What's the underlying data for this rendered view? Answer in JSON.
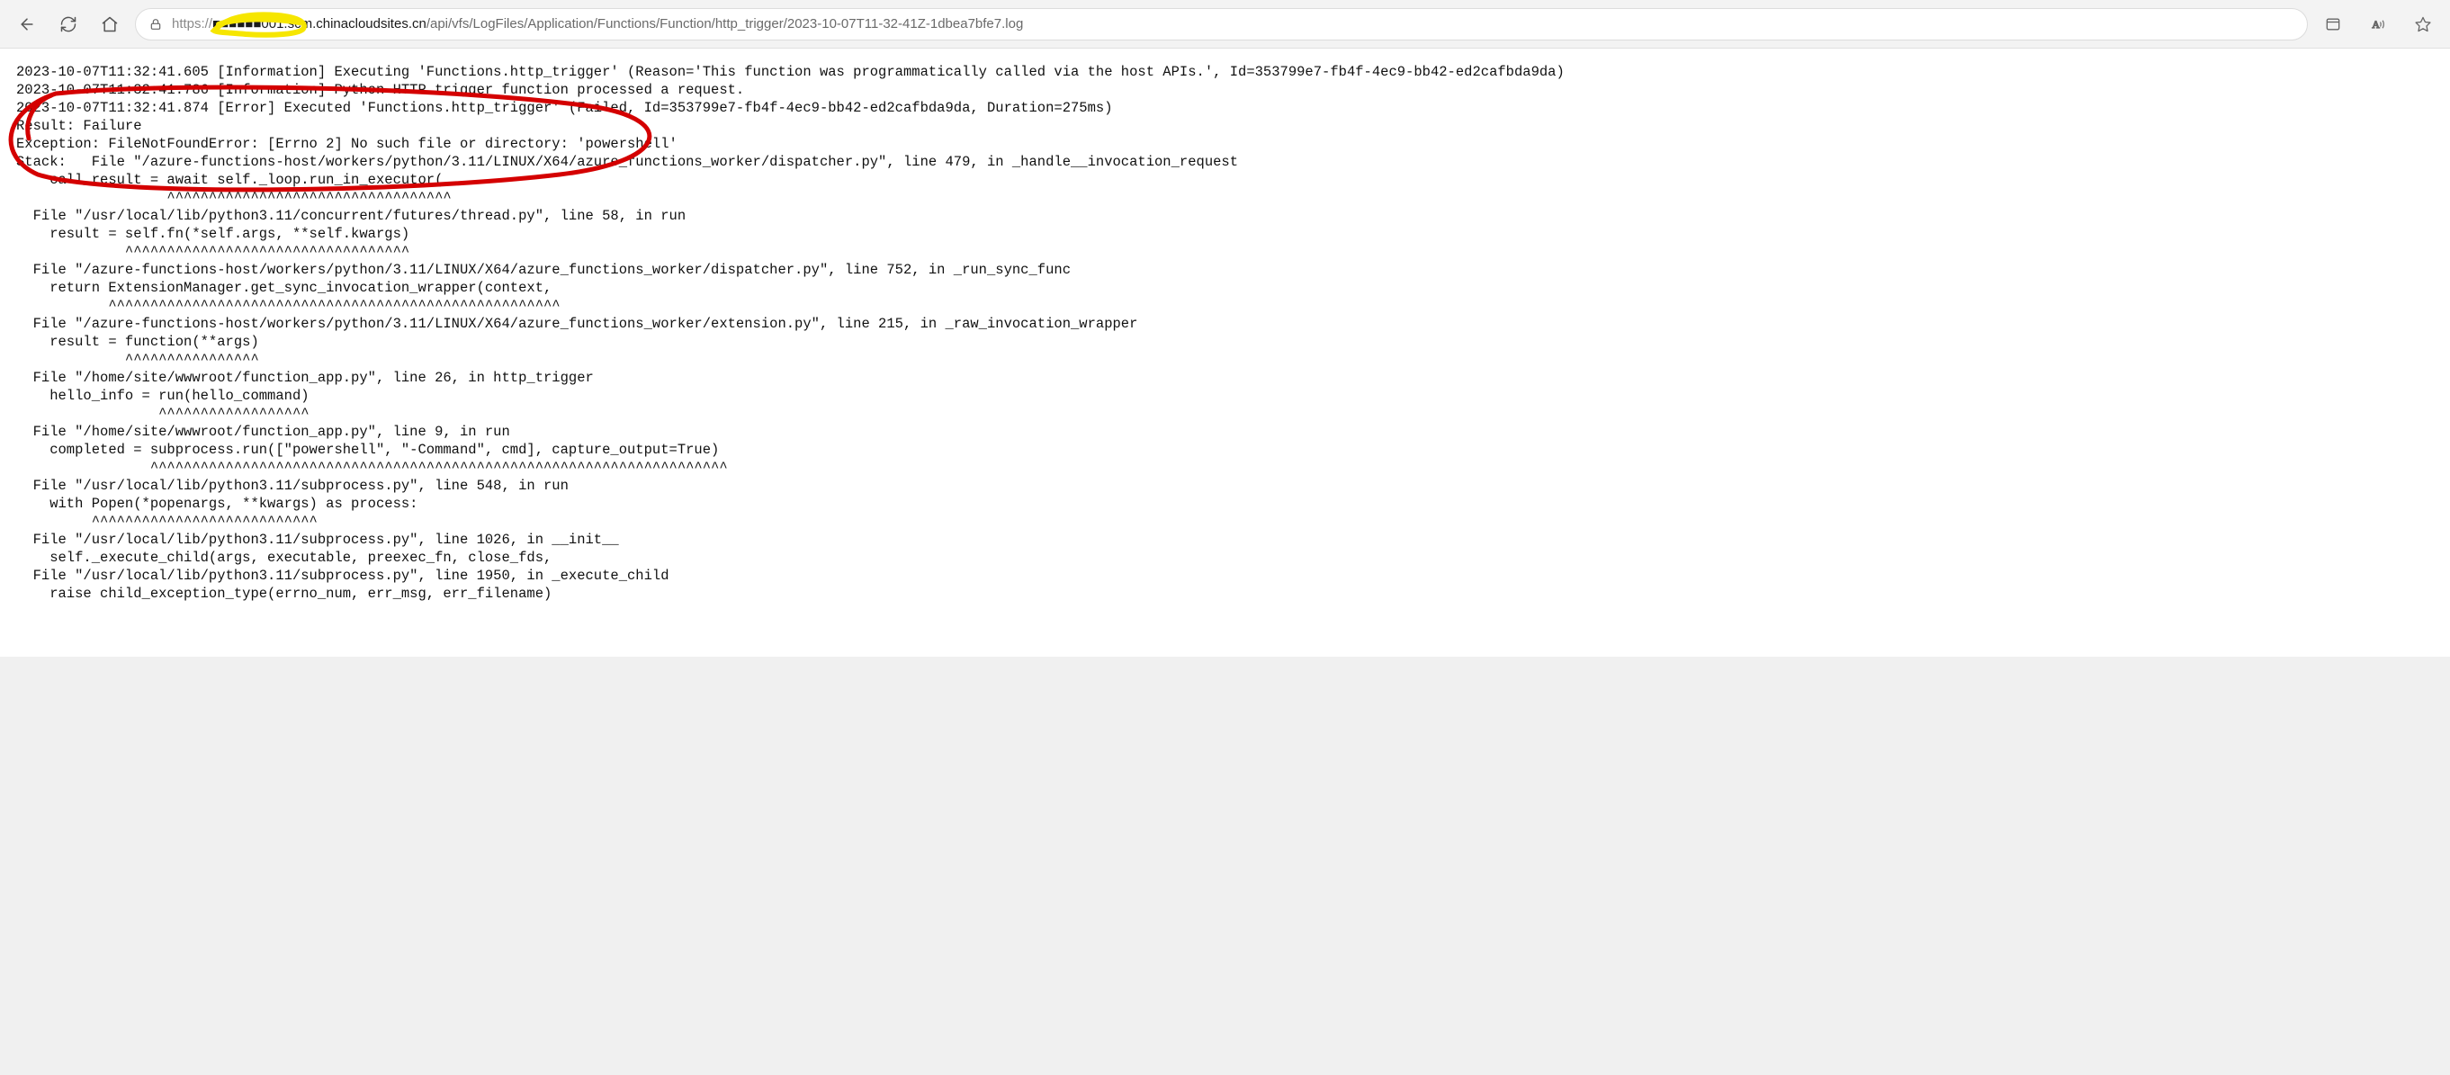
{
  "browser": {
    "url_scheme": "https://",
    "url_redacted_sub": "■■■■■■001.s",
    "url_host_suffix": "cm.chinacloudsites.cn",
    "url_path": "/api/vfs/LogFiles/Application/Functions/Function/http_trigger/2023-10-07T11-32-41Z-1dbea7bfe7.log",
    "icons": {
      "back": "back-icon",
      "refresh": "refresh-icon",
      "home": "home-icon",
      "lock": "lock-icon",
      "app": "app-icon",
      "read_aloud": "read-aloud-icon",
      "favorite": "star-icon"
    }
  },
  "log_lines": [
    "2023-10-07T11:32:41.605 [Information] Executing 'Functions.http_trigger' (Reason='This function was programmatically called via the host APIs.', Id=353799e7-fb4f-4ec9-bb42-ed2cafbda9da)",
    "2023-10-07T11:32:41.786 [Information] Python HTTP trigger function processed a request.",
    "2023-10-07T11:32:41.874 [Error] Executed 'Functions.http_trigger' (Failed, Id=353799e7-fb4f-4ec9-bb42-ed2cafbda9da, Duration=275ms)",
    "Result: Failure",
    "Exception: FileNotFoundError: [Errno 2] No such file or directory: 'powershell'",
    "Stack:   File \"/azure-functions-host/workers/python/3.11/LINUX/X64/azure_functions_worker/dispatcher.py\", line 479, in _handle__invocation_request",
    "    call_result = await self._loop.run_in_executor(",
    "                  ^^^^^^^^^^^^^^^^^^^^^^^^^^^^^^^^^^",
    "  File \"/usr/local/lib/python3.11/concurrent/futures/thread.py\", line 58, in run",
    "    result = self.fn(*self.args, **self.kwargs)",
    "             ^^^^^^^^^^^^^^^^^^^^^^^^^^^^^^^^^^",
    "  File \"/azure-functions-host/workers/python/3.11/LINUX/X64/azure_functions_worker/dispatcher.py\", line 752, in _run_sync_func",
    "    return ExtensionManager.get_sync_invocation_wrapper(context,",
    "           ^^^^^^^^^^^^^^^^^^^^^^^^^^^^^^^^^^^^^^^^^^^^^^^^^^^^^^",
    "  File \"/azure-functions-host/workers/python/3.11/LINUX/X64/azure_functions_worker/extension.py\", line 215, in _raw_invocation_wrapper",
    "    result = function(**args)",
    "             ^^^^^^^^^^^^^^^^",
    "  File \"/home/site/wwwroot/function_app.py\", line 26, in http_trigger",
    "    hello_info = run(hello_command)",
    "                 ^^^^^^^^^^^^^^^^^^",
    "  File \"/home/site/wwwroot/function_app.py\", line 9, in run",
    "    completed = subprocess.run([\"powershell\", \"-Command\", cmd], capture_output=True)",
    "                ^^^^^^^^^^^^^^^^^^^^^^^^^^^^^^^^^^^^^^^^^^^^^^^^^^^^^^^^^^^^^^^^^^^^^",
    "  File \"/usr/local/lib/python3.11/subprocess.py\", line 548, in run",
    "    with Popen(*popenargs, **kwargs) as process:",
    "         ^^^^^^^^^^^^^^^^^^^^^^^^^^^",
    "  File \"/usr/local/lib/python3.11/subprocess.py\", line 1026, in __init__",
    "    self._execute_child(args, executable, preexec_fn, close_fds,",
    "  File \"/usr/local/lib/python3.11/subprocess.py\", line 1950, in _execute_child",
    "    raise child_exception_type(errno_num, err_msg, err_filename)"
  ]
}
